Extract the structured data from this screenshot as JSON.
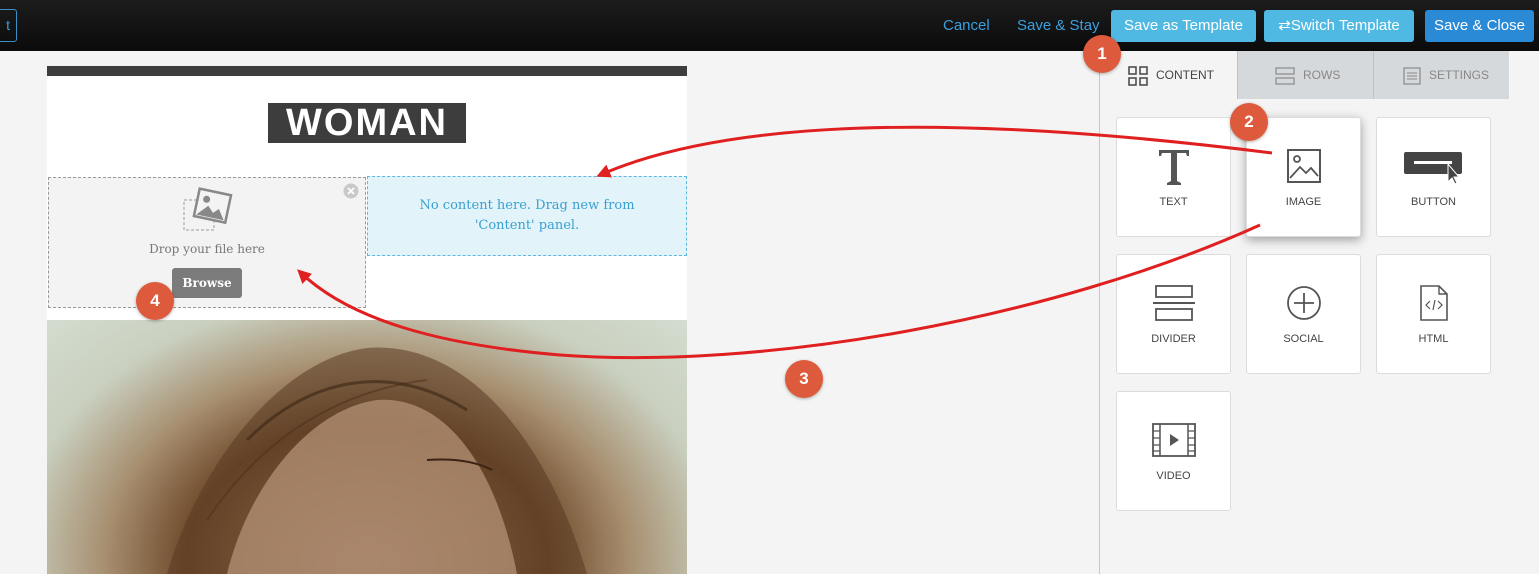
{
  "toolbar": {
    "back_label": "t",
    "cancel_label": "Cancel",
    "save_stay_label": "Save & Stay",
    "save_template_label": "Save as Template",
    "switch_template_label": "Switch Template",
    "save_close_label": "Save & Close"
  },
  "email": {
    "logo_text": "WOMAN",
    "image_block": {
      "drop_text": "Drop your file here",
      "browse_label": "Browse"
    },
    "empty_block_text": "No content here. Drag new from 'Content' panel."
  },
  "panel": {
    "tabs": [
      {
        "label": "CONTENT",
        "icon": "grid-icon",
        "active": true
      },
      {
        "label": "ROWS",
        "icon": "rows-icon",
        "active": false
      },
      {
        "label": "SETTINGS",
        "icon": "settings-list-icon",
        "active": false
      }
    ],
    "tiles": [
      {
        "label": "TEXT",
        "icon": "text-icon"
      },
      {
        "label": "IMAGE",
        "icon": "image-icon"
      },
      {
        "label": "BUTTON",
        "icon": "button-icon"
      },
      {
        "label": "DIVIDER",
        "icon": "divider-icon"
      },
      {
        "label": "SOCIAL",
        "icon": "social-icon"
      },
      {
        "label": "HTML",
        "icon": "html-icon"
      },
      {
        "label": "VIDEO",
        "icon": "video-icon"
      }
    ]
  },
  "annotations": {
    "badges": [
      "1",
      "2",
      "3",
      "4"
    ],
    "color": "#de5a3c",
    "arrow_color": "#e02020"
  },
  "colors": {
    "link_blue": "#3aa0e0",
    "light_button": "#4fb9e3",
    "primary_button": "#2b8ad6",
    "dark_logo": "#3d3d3d"
  }
}
